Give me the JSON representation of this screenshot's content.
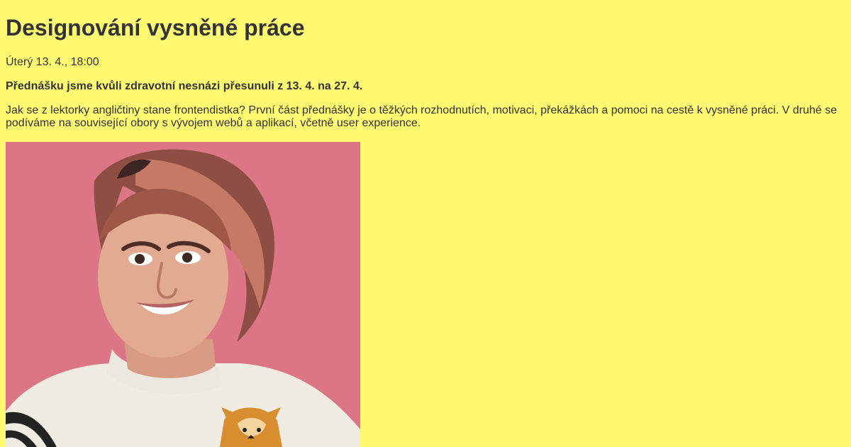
{
  "event": {
    "title": "Designování vysněné práce",
    "date": "Úterý 13. 4., 18:00",
    "notice": "Přednášku jsme kvůli zdravotní nesnázi přesunuli z 13. 4. na 27. 4.",
    "description": "Jak se z lektorky angličtiny stane frontendistka? První část přednášky je o těžkých rozhodnutích, motivaci, překážkách a pomoci na cestě k vysněné práci. V druhé se podíváme na související obory s vývojem webů a aplikací, včetně user experience."
  },
  "colors": {
    "page_background": "#fffa72",
    "text": "#333333",
    "photo_background": "#dc7585"
  },
  "image": {
    "subject_icon": "speaker-portrait"
  }
}
